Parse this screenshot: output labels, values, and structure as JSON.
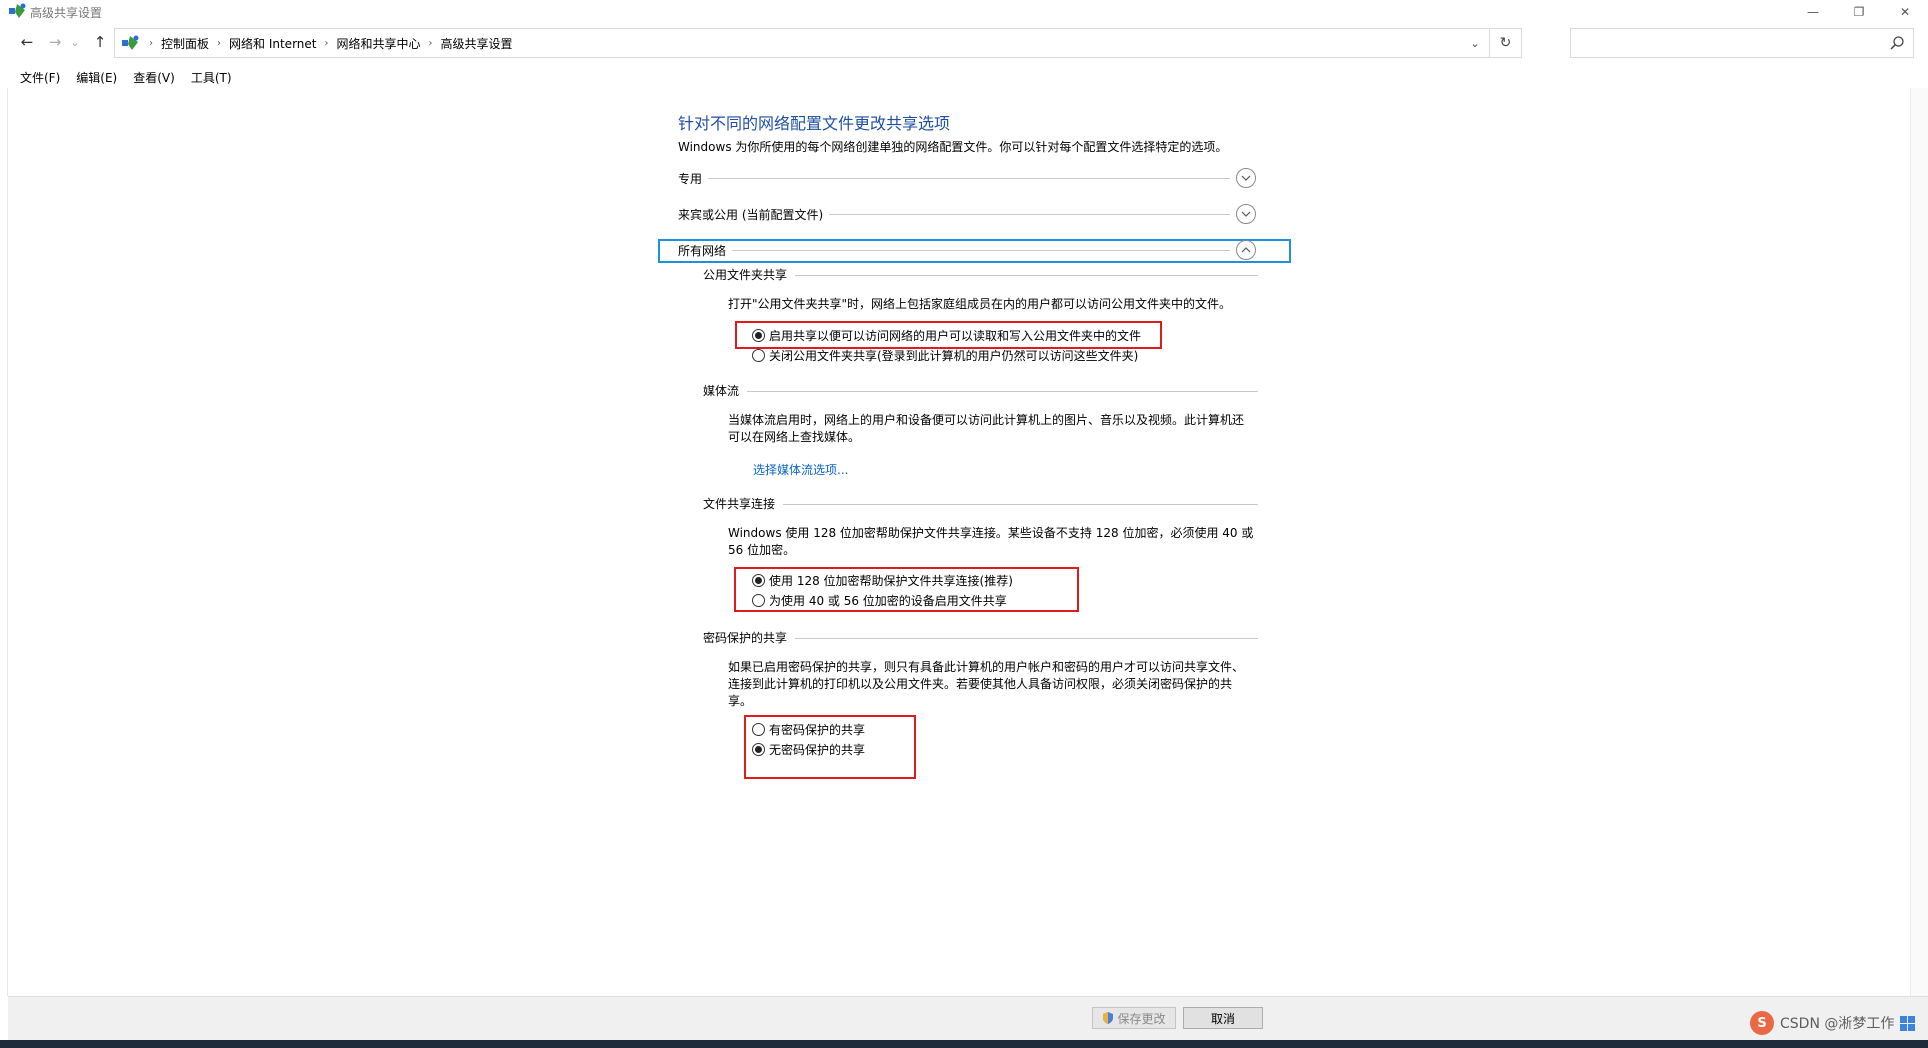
{
  "window": {
    "title": "高级共享设置",
    "minimize_glyph": "—",
    "restore_glyph": "❐",
    "close_glyph": "✕"
  },
  "nav": {
    "back_glyph": "←",
    "forward_glyph": "→",
    "history_glyph": "⌄",
    "up_glyph": "↑",
    "breadcrumbs": [
      "控制面板",
      "网络和 Internet",
      "网络和共享中心",
      "高级共享设置"
    ],
    "separator": "›",
    "dropdown_glyph": "⌄",
    "refresh_glyph": "↻",
    "search_placeholder": ""
  },
  "menu": [
    "文件(F)",
    "编辑(E)",
    "查看(V)",
    "工具(T)"
  ],
  "page": {
    "title": "针对不同的网络配置文件更改共享选项",
    "description": "Windows 为你所使用的每个网络创建单独的网络配置文件。你可以针对每个配置文件选择特定的选项。"
  },
  "profiles": {
    "private": "专用",
    "guest_public": "来宾或公用 (当前配置文件)",
    "all_networks": "所有网络"
  },
  "sections": {
    "public_folder": {
      "title": "公用文件夹共享",
      "description": "打开\"公用文件夹共享\"时，网络上包括家庭组成员在内的用户都可以访问公用文件夹中的文件。",
      "options": [
        {
          "label": "启用共享以便可以访问网络的用户可以读取和写入公用文件夹中的文件",
          "selected": true
        },
        {
          "label": "关闭公用文件夹共享(登录到此计算机的用户仍然可以访问这些文件夹)",
          "selected": false
        }
      ]
    },
    "media": {
      "title": "媒体流",
      "description_line1": "当媒体流启用时，网络上的用户和设备便可以访问此计算机上的图片、音乐以及视频。此计算机还",
      "description_line2": "可以在网络上查找媒体。",
      "link": "选择媒体流选项..."
    },
    "file_sharing": {
      "title": "文件共享连接",
      "description_line1": "Windows 使用 128 位加密帮助保护文件共享连接。某些设备不支持 128 位加密，必须使用 40 或",
      "description_line2": "56 位加密。",
      "options": [
        {
          "label": "使用 128 位加密帮助保护文件共享连接(推荐)",
          "selected": true
        },
        {
          "label": "为使用 40 或 56 位加密的设备启用文件共享",
          "selected": false
        }
      ]
    },
    "password": {
      "title": "密码保护的共享",
      "description_line1": "如果已启用密码保护的共享，则只有具备此计算机的用户帐户和密码的用户才可以访问共享文件、",
      "description_line2": "连接到此计算机的打印机以及公用文件夹。若要使其他人具备访问权限，必须关闭密码保护的共",
      "description_line3": "享。",
      "options": [
        {
          "label": "有密码保护的共享",
          "selected": false
        },
        {
          "label": "无密码保护的共享",
          "selected": true
        }
      ]
    }
  },
  "footer": {
    "save_label": "保存更改",
    "cancel_label": "取消"
  },
  "watermark": {
    "logo_text": "S",
    "text": "CSDN @淅梦工作"
  },
  "colors": {
    "title_blue": "#1e4fa3",
    "link_blue": "#0a64c8",
    "highlight_border": "#1e90e0",
    "annotation_red": "#e01b1b"
  }
}
